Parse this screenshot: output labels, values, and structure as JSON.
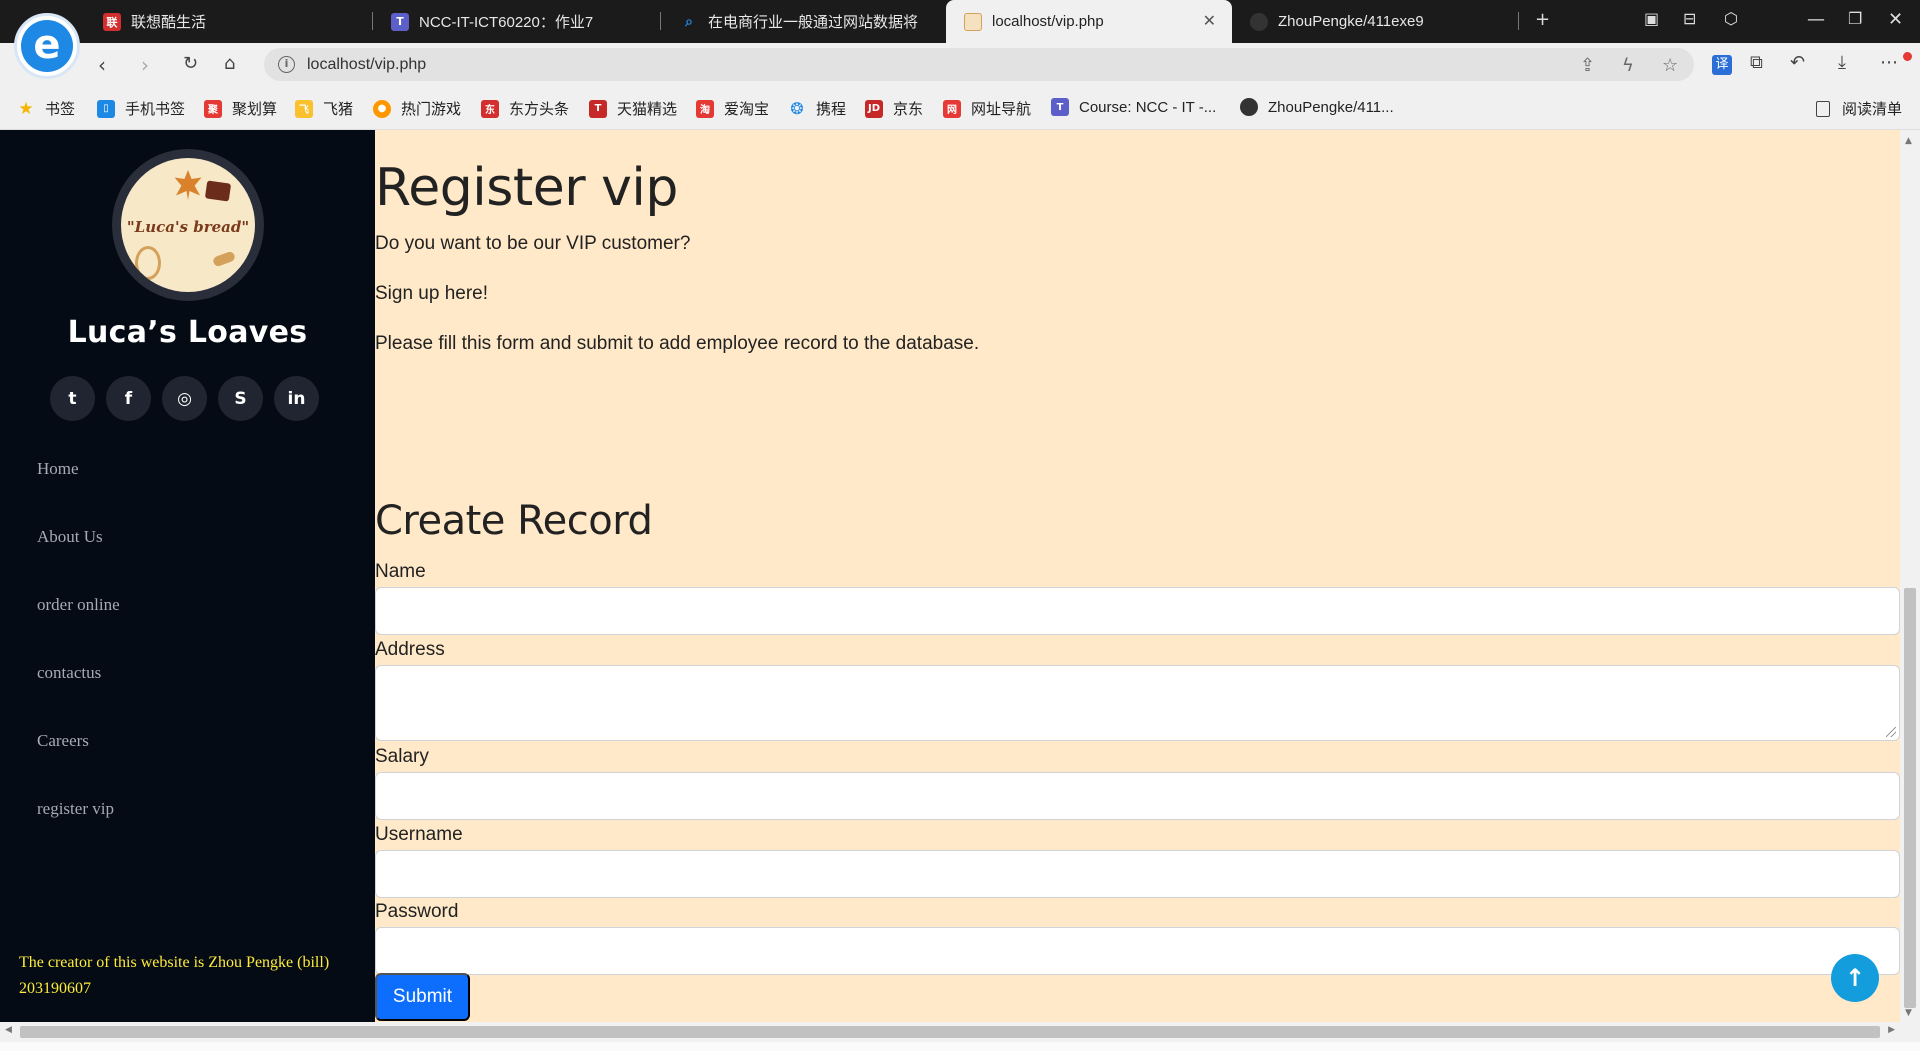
{
  "browser": {
    "tabs": [
      {
        "label": "联想酷生活",
        "icon": "lenovo-icon",
        "color": "#d32f2f"
      },
      {
        "label": "NCC-IT-ICT60220：作业7",
        "icon": "teams-icon",
        "color": "#5b5fc7"
      },
      {
        "label": "在电商行业一般通过网站数据将",
        "icon": "search-icon",
        "color": "#1e88e5"
      },
      {
        "label": "localhost/vip.php",
        "icon": "page-icon",
        "color": "#d4a15b",
        "active": true
      },
      {
        "label": "ZhouPengke/411exe9",
        "icon": "github-icon",
        "color": "#333333"
      }
    ],
    "url": "localhost/vip.php",
    "bookmarks": [
      {
        "label": "书签",
        "icon": "star-icon",
        "color": "#f5b400"
      },
      {
        "label": "手机书签",
        "icon": "phone-icon",
        "color": "#1e88e5"
      },
      {
        "label": "聚划算",
        "icon": "juhuasuan-icon",
        "color": "#e53935"
      },
      {
        "label": "飞猪",
        "icon": "fliggy-icon",
        "color": "#fbc02d"
      },
      {
        "label": "热门游戏",
        "icon": "game-icon",
        "color": "#ff9800"
      },
      {
        "label": "东方头条",
        "icon": "news-icon",
        "color": "#d32f2f"
      },
      {
        "label": "天猫精选",
        "icon": "tmall-icon",
        "color": "#c62828"
      },
      {
        "label": "爱淘宝",
        "icon": "taobao-icon",
        "color": "#e53935"
      },
      {
        "label": "携程",
        "icon": "ctrip-icon",
        "color": "#1e88e5"
      },
      {
        "label": "京东",
        "icon": "jd-icon",
        "color": "#c62828"
      },
      {
        "label": "网址导航",
        "icon": "nav-icon",
        "color": "#e53935"
      },
      {
        "label": "Course: NCC - IT -...",
        "icon": "teams-icon",
        "color": "#5b5fc7"
      },
      {
        "label": "ZhouPengke/411...",
        "icon": "github-icon",
        "color": "#333333"
      }
    ],
    "reading_list": "阅读清单"
  },
  "sidebar": {
    "logo_text": "\"Luca's bread\"",
    "brand": "Luca’s Loaves",
    "socials": [
      {
        "name": "twitter-icon",
        "glyph": "t"
      },
      {
        "name": "facebook-icon",
        "glyph": "f"
      },
      {
        "name": "instagram-icon",
        "glyph": "◎"
      },
      {
        "name": "skype-icon",
        "glyph": "S"
      },
      {
        "name": "linkedin-icon",
        "glyph": "in"
      }
    ],
    "nav": [
      "Home",
      "About Us",
      "order online",
      "contactus",
      "Careers",
      "register vip"
    ],
    "credit": "The creator of this website is Zhou Pengke (bill) 203190607"
  },
  "main": {
    "title": "Register vip",
    "intro": "Do you want to be our VIP customer?",
    "signup": "Sign up here!",
    "instruction": "Please fill this form and submit to add employee record to the database.",
    "form_title": "Create Record",
    "fields": [
      {
        "label": "Name",
        "value": ""
      },
      {
        "label": "Address",
        "value": ""
      },
      {
        "label": "Salary",
        "value": ""
      },
      {
        "label": "Username",
        "value": ""
      },
      {
        "label": "Password",
        "value": ""
      }
    ],
    "submit": "Submit",
    "back_to_top_icon": "arrow-up-icon"
  }
}
